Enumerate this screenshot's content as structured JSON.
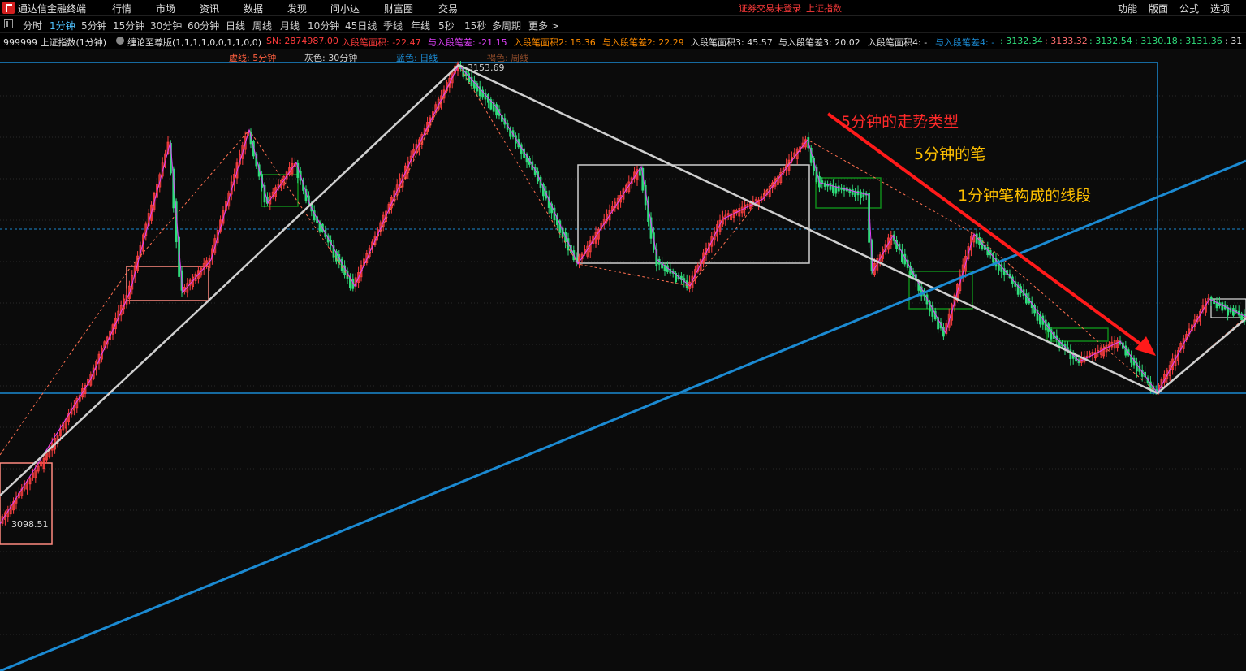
{
  "app": {
    "title": "通达信金融终端",
    "menu": [
      "行情",
      "市场",
      "资讯",
      "数据",
      "发现",
      "问小达",
      "财富圈",
      "交易"
    ],
    "notice": "证券交易未登录",
    "notice_security": "上证指数",
    "right_menu": [
      "功能",
      "版面",
      "公式",
      "选项"
    ]
  },
  "periods": {
    "items": [
      "分时",
      "1分钟",
      "5分钟",
      "15分钟",
      "30分钟",
      "60分钟",
      "日线",
      "周线",
      "月线",
      "10分钟",
      "45日线",
      "季线",
      "年线",
      "5秒",
      "15秒",
      "多周期",
      "更多 >"
    ],
    "active": "1分钟"
  },
  "info": {
    "security": "999999 上证指数(1分钟)",
    "indicator": "缠论至尊版(1,1,1,1,0,0,1,1,0,0)",
    "sn": "SN: 2874987.00",
    "f1": "入段笔面积: -22.47",
    "f2": "与入段笔差: -21.15",
    "f3": "入段笔面积2: 15.36",
    "f4": "与入段笔差2: 22.29",
    "f5": "入段笔面积3: 45.57",
    "f6": "与入段笔差3: 20.02",
    "f7": "入段笔面积4: -",
    "f8": "与入段笔差4: -",
    "v1": ": 3132.34",
    "v2": ": 3133.32",
    "v3": ": 3132.54",
    "v4": ": 3130.18",
    "v5": ": 3131.36",
    "v6": ": 31"
  },
  "legend": {
    "dashed": "虚线: 5分钟",
    "gray": "灰色: 30分钟",
    "blue": "蓝色: 日线",
    "brown": "褐色: 周线"
  },
  "chart": {
    "high_label": "3153.69",
    "low_label": "3098.51",
    "annotations": {
      "trend_type": "5分钟的走势类型",
      "stroke": "5分钟的笔",
      "segment": "1分钟笔构成的线段"
    },
    "colors": {
      "up": "#ff4040",
      "down": "#2fdc7a",
      "blue": "#1b8ad2",
      "gray": "#cfcfcf",
      "magenta": "#e040fb",
      "salmon": "#ff8a80",
      "green_box": "#0f8a1a",
      "orange_text": "#ffc000",
      "red_text": "#ff2a2a"
    }
  }
}
